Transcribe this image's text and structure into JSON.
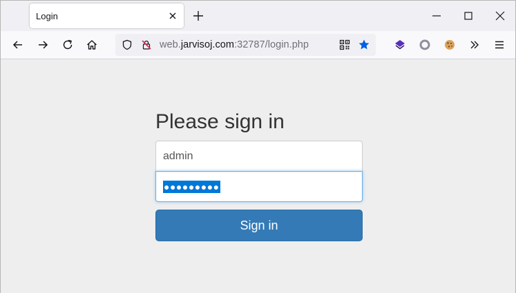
{
  "tab": {
    "title": "Login"
  },
  "url": {
    "prefix": "web.",
    "host": "jarvisoj.com",
    "suffix": ":32787/login.php"
  },
  "page": {
    "heading": "Please sign in",
    "username_value": "admin",
    "password_value": "●●●●●●●●●",
    "signin_label": "Sign in"
  },
  "icons": {
    "star_color": "#0060df",
    "button_color": "#337ab7",
    "selection_color": "#0078d7"
  }
}
